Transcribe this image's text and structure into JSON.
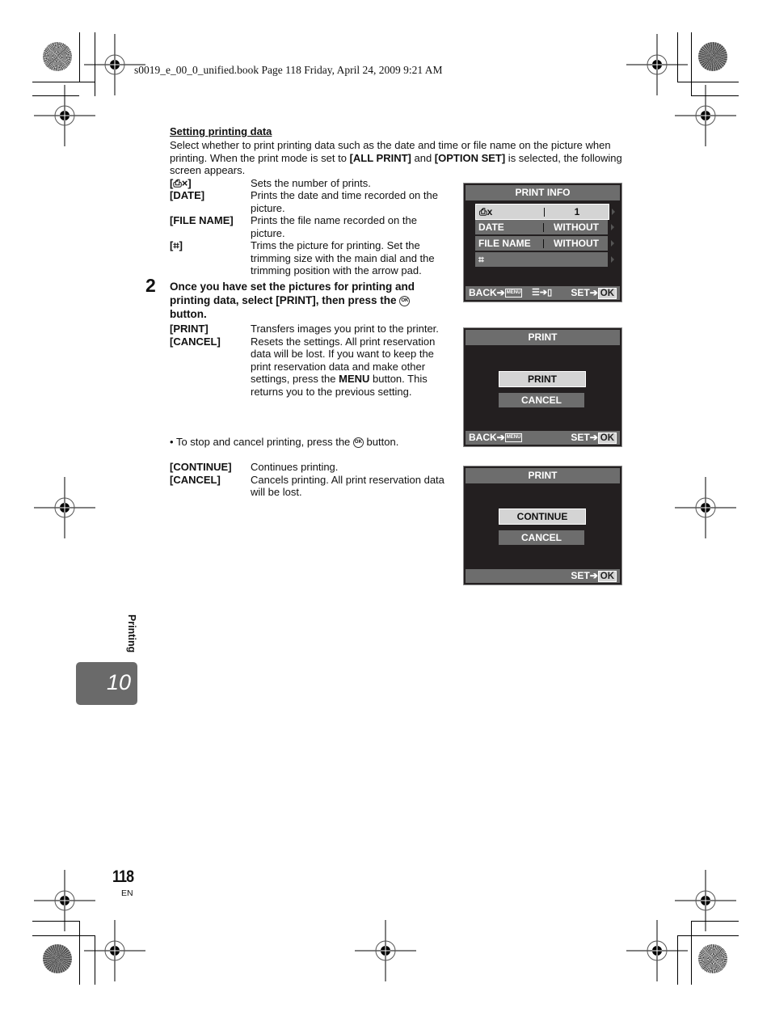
{
  "header": {
    "print_slug": "s0019_e_00_0_unified.book  Page 118  Friday, April 24, 2009  9:21 AM"
  },
  "section": {
    "title": "Setting printing data",
    "intro_parts": [
      "Select whether to print printing data such as the date and time or file name on the picture when printing. When the print mode is set to ",
      "[ALL PRINT]",
      " and ",
      "[OPTION SET]",
      " is selected, the following screen appears."
    ],
    "definitions": [
      {
        "term": "[⎙×]",
        "desc": "Sets the number of prints."
      },
      {
        "term": "[DATE]",
        "desc": "Prints the date and time recorded on the picture."
      },
      {
        "term": "[FILE NAME]",
        "desc": "Prints the file name recorded on the picture."
      },
      {
        "term": "[⌗]",
        "desc": "Trims the picture for printing. Set the trimming size with the main dial and the trimming position with the arrow pad."
      }
    ]
  },
  "step2": {
    "number": "2",
    "instruction_before": "Once you have set the pictures for printing and printing data, select [PRINT], then press the",
    "instruction_icon": "OK",
    "instruction_after": "button.",
    "definitions": [
      {
        "term": "[PRINT]",
        "desc": "Transfers images you print to the printer."
      },
      {
        "term": "[CANCEL]",
        "desc_before": "Resets the settings. All print reservation data will be lost. If you want to keep the print reservation data and make other settings, press the ",
        "desc_bold": "MENU",
        "desc_after": " button. This returns you to the previous setting."
      }
    ],
    "bullet_before": "To stop and cancel printing, press the",
    "bullet_icon": "OK",
    "bullet_after": "button.",
    "definitions2": [
      {
        "term": "[CONTINUE]",
        "desc": "Continues printing."
      },
      {
        "term": "[CANCEL]",
        "desc": "Cancels printing. All print reservation data will be lost."
      }
    ]
  },
  "screens": {
    "print_info": {
      "title": "PRINT INFO",
      "rows": [
        {
          "label": "⎙x",
          "value": "1",
          "selected": true
        },
        {
          "label": "DATE",
          "value": "WITHOUT",
          "selected": false
        },
        {
          "label": "FILE NAME",
          "value": "WITHOUT",
          "selected": false
        },
        {
          "label": "⌗",
          "value": "",
          "selected": false
        }
      ],
      "footer": {
        "back": "BACK",
        "menu": "MENU",
        "set": "SET",
        "ok": "OK"
      }
    },
    "print": {
      "title": "PRINT",
      "buttons": [
        {
          "label": "PRINT",
          "selected": true
        },
        {
          "label": "CANCEL",
          "selected": false
        }
      ],
      "footer": {
        "back": "BACK",
        "menu": "MENU",
        "set": "SET",
        "ok": "OK"
      }
    },
    "printing": {
      "title": "PRINT",
      "buttons": [
        {
          "label": "CONTINUE",
          "selected": true
        },
        {
          "label": "CANCEL",
          "selected": false
        }
      ],
      "footer": {
        "set": "SET",
        "ok": "OK"
      }
    }
  },
  "side_tab": {
    "label": "Printing",
    "chapter": "10"
  },
  "footer": {
    "page_number": "118",
    "language": "EN"
  }
}
